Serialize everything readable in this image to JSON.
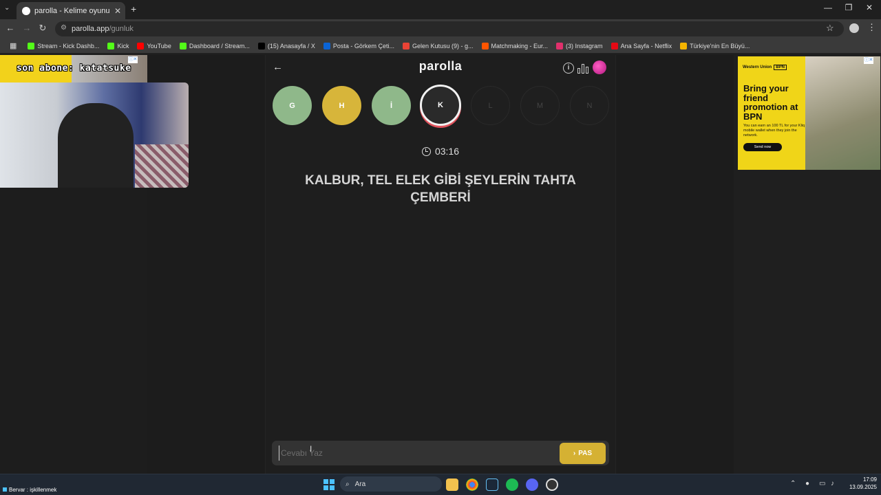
{
  "browser": {
    "tab_title": "parolla - Kelime oyunu. Günlük",
    "tab_close": "✕",
    "new_tab": "+",
    "url_host": "parolla.app",
    "url_path": "/gunluk",
    "bookmarks": [
      {
        "label": "Stream - Kick Dashb...",
        "color": "#53fc18"
      },
      {
        "label": "Kick",
        "color": "#53fc18"
      },
      {
        "label": "YouTube",
        "color": "#ff0000"
      },
      {
        "label": "Dashboard / Stream...",
        "color": "#53fc18"
      },
      {
        "label": "(15) Anasayfa / X",
        "color": "#000000"
      },
      {
        "label": "Posta - Görkem Çeti...",
        "color": "#0a64d6"
      },
      {
        "label": "Gelen Kutusu (9) - g...",
        "color": "#ea4335"
      },
      {
        "label": "Matchmaking - Eur...",
        "color": "#ff5500"
      },
      {
        "label": "(3) Instagram",
        "color": "#e1306c"
      },
      {
        "label": "Ana Sayfa - Netflix",
        "color": "#e50914"
      },
      {
        "label": "Türkiye'nin En Büyü...",
        "color": "#f4b400"
      }
    ]
  },
  "overlay": {
    "subscriber_text": "son abone: katatsuke"
  },
  "game": {
    "logo": "parolla",
    "back_icon": "back-arrow-icon",
    "letters": [
      {
        "letter": "G",
        "state": "correct"
      },
      {
        "letter": "H",
        "state": "passed"
      },
      {
        "letter": "İ",
        "state": "correct"
      },
      {
        "letter": "K",
        "state": "current"
      },
      {
        "letter": "L",
        "state": "upcoming"
      },
      {
        "letter": "M",
        "state": "upcoming"
      },
      {
        "letter": "N",
        "state": "upcoming"
      }
    ],
    "timer": "03:16",
    "question": "KALBUR, TEL ELEK GİBİ ŞEYLERİN TAHTA ÇEMBERİ",
    "answer_placeholder": "Cevabı Yaz",
    "pass_label": "PAS",
    "colors": {
      "correct": "#8fb88a",
      "passed": "#d7b53a",
      "current_ring": "#e0525c"
    }
  },
  "ad": {
    "brand_left": "Western Union",
    "brand_right": "BPN",
    "headline": "Bring your friend promotion at BPN",
    "body": "You can earn an 100 TL for your Kliq mobile wallet when they join the network.",
    "cta": "Send now"
  },
  "taskbar": {
    "status_text": "Bervar : işkillenmek",
    "search_label": "Ara",
    "time": "17:09",
    "date": "13.09.2025"
  }
}
